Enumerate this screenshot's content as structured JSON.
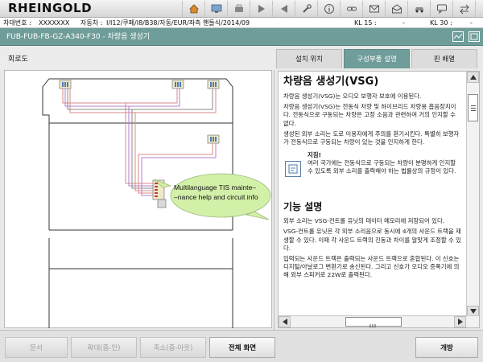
{
  "header": {
    "brand": "RHEINGOLD",
    "toolbar_icons": [
      "home-icon",
      "network-icon",
      "print-icon",
      "forward-icon",
      "back-icon",
      "wrench-icon",
      "info-icon",
      "link-icon",
      "mail-icon",
      "mail-open-icon",
      "car-icon",
      "chat-icon",
      "arrows-icon",
      "help-icon",
      "close-icon"
    ]
  },
  "vehicle": {
    "vin_label": "차대번호 :",
    "vin_value": "XXXXXXX",
    "model_label": "자동차 :",
    "model_value": "I/I12/쿠페/I8/B38/자동/EUR/좌측 핸들식/2014/09",
    "kl15": "KL 15 :",
    "kl15_value": "-",
    "kl30": "KL 30 :",
    "kl30_value": "-"
  },
  "titlebar": {
    "title": "FUB-FUB-FB-GZ-A340-F30  -  차량음 생성기"
  },
  "left_panel": {
    "tab_label": "회로도"
  },
  "callout": {
    "text": "Multilanguage TIS mainte–\n–nance help and circuit info"
  },
  "right_panel": {
    "tabs": [
      {
        "label": "설치 위치",
        "active": false
      },
      {
        "label": "구성부품 설명",
        "active": true
      },
      {
        "label": "핀 배열",
        "active": false
      }
    ]
  },
  "document": {
    "heading1": "차량음 생성기(VSG)",
    "p1": "차량음 생성기(VSG)는 오디오 보행자 보호에 이용된다.",
    "p2": "차량음 생성기(VSG)는 전동식 차량 및 하이브리드 차량용 흡음장치이다. 전동식으로 구동되는 차량은 고정 소음과 관련하여 거의 인지할 수 없다.",
    "p3": "생성된 외부 소리는 도로 이용자에게 주의를 환기시킨다. 특별히 보행자가 전동식으로 구동되는 차량이 있는 것을 인지하게 한다.",
    "note_title": "지침!",
    "note_text": "여러 국가에는 전동식으로 구동되는 차량이 분명하게 인지할 수 있도록 외부 소리를 출력해야 하는 법률상의 규정이 있다.",
    "heading2": "기능 설명",
    "f1": "외부 소리는 VSG-컨트롤 유닛의 데이터 메모리에 저장되어 있다.",
    "f2": "VSG-컨트롤 유닛은 각 외부 소리음으로 동시에 4개의 사운드 트랙을 재생할 수 있다. 이때 각 사운드 트랙의 진동과 차이를 알맞게 조정할 수 있다.",
    "f3": "입력되는 사운드 트랙은 출력되는 사운드 트랙으로 혼합된다. 이 신호는 디지털/아날로그 변환기로 송신된다. 그리고 신호가 오디오 증폭기에 의해 외부 스피커로 22W로 출력된다."
  },
  "bottom_bar": {
    "btn_document": "문서",
    "btn_zoom_in": "확대(줌-인)",
    "btn_zoom_out": "축소(줌-아웃)",
    "btn_fullscreen": "전체 화면",
    "btn_open": "개방"
  }
}
